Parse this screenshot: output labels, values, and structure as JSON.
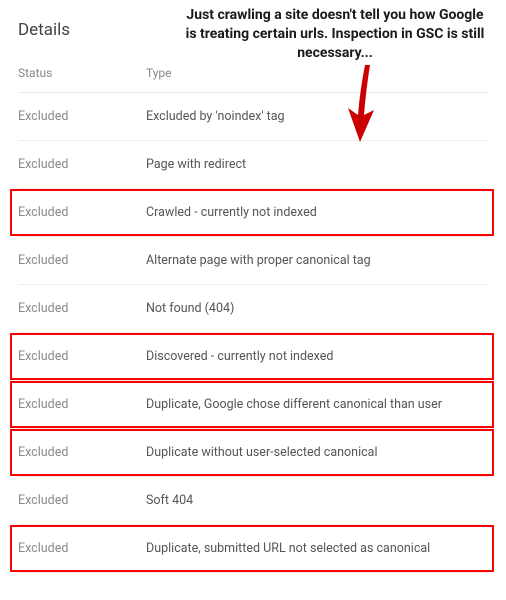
{
  "panel": {
    "title": "Details"
  },
  "header": {
    "status": "Status",
    "type": "Type"
  },
  "rows": [
    {
      "status": "Excluded",
      "type": "Excluded by 'noindex' tag",
      "highlighted": false
    },
    {
      "status": "Excluded",
      "type": "Page with redirect",
      "highlighted": false
    },
    {
      "status": "Excluded",
      "type": "Crawled - currently not indexed",
      "highlighted": true
    },
    {
      "status": "Excluded",
      "type": "Alternate page with proper canonical tag",
      "highlighted": false
    },
    {
      "status": "Excluded",
      "type": "Not found (404)",
      "highlighted": false
    },
    {
      "status": "Excluded",
      "type": "Discovered - currently not indexed",
      "highlighted": true
    },
    {
      "status": "Excluded",
      "type": "Duplicate, Google chose different canonical than user",
      "highlighted": true
    },
    {
      "status": "Excluded",
      "type": "Duplicate without user-selected canonical",
      "highlighted": true
    },
    {
      "status": "Excluded",
      "type": "Soft 404",
      "highlighted": false
    },
    {
      "status": "Excluded",
      "type": "Duplicate, submitted URL not selected as canonical",
      "highlighted": true
    }
  ],
  "annotation": {
    "text": "Just crawling a site doesn't tell you how Google is treating certain urls. Inspection in GSC is still necessary...",
    "color": "#cc0000"
  }
}
